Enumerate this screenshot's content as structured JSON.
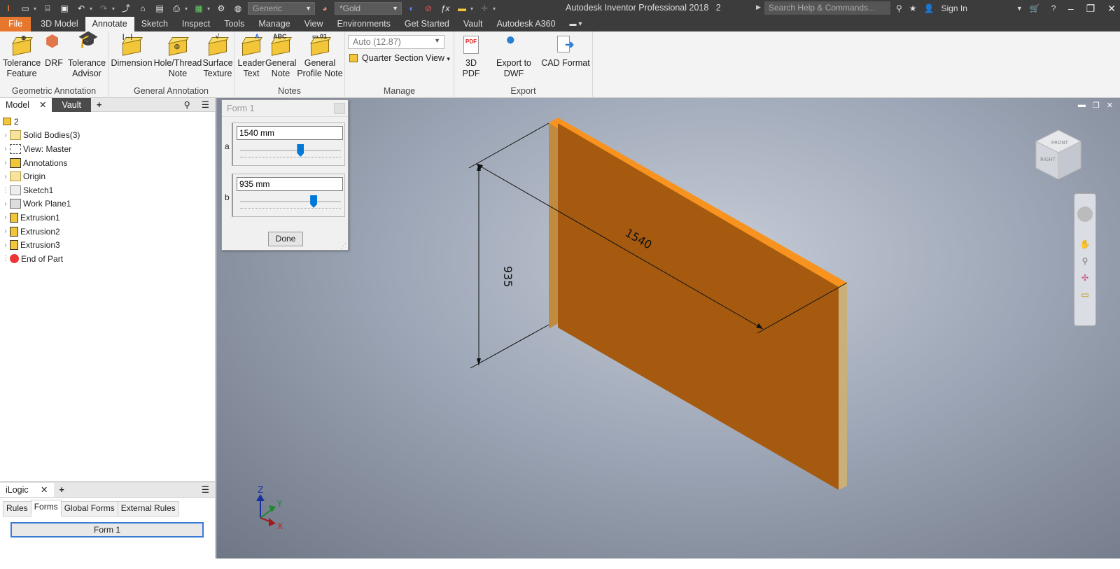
{
  "titlebar": {
    "app_title": "Autodesk Inventor Professional 2018",
    "document": "2",
    "search_placeholder": "Search Help & Commands...",
    "sign_in": "Sign In",
    "material_combo": "Generic",
    "appearance_combo": "*Gold"
  },
  "ribbon_tabs": [
    "File",
    "3D Model",
    "Annotate",
    "Sketch",
    "Inspect",
    "Tools",
    "Manage",
    "View",
    "Environments",
    "Get Started",
    "Vault",
    "Autodesk A360"
  ],
  "active_tab": "Annotate",
  "ribbon": {
    "geometric": {
      "title": "Geometric Annotation",
      "tolerance_feature": [
        "Tolerance",
        "Feature"
      ],
      "drf": "DRF",
      "tolerance_advisor": [
        "Tolerance",
        "Advisor"
      ]
    },
    "general": {
      "title": "General Annotation",
      "dimension": "Dimension",
      "hole_thread": [
        "Hole/Thread",
        "Note"
      ],
      "surface_texture": [
        "Surface",
        "Texture"
      ]
    },
    "notes": {
      "title": "Notes",
      "leader_text": [
        "Leader",
        "Text"
      ],
      "general_note": [
        "General",
        "Note"
      ],
      "general_profile_note": [
        "General",
        "Profile Note"
      ]
    },
    "manage": {
      "title": "Manage",
      "scale_combo": "Auto (12.87)",
      "quarter_section": "Quarter Section View"
    },
    "export": {
      "title": "Export",
      "pdf": "3D PDF",
      "dwf": "Export to DWF",
      "cad": "CAD Format"
    }
  },
  "browser": {
    "tabs": [
      "Model",
      "Vault"
    ],
    "root": "2",
    "items": [
      "Solid Bodies(3)",
      "View: Master",
      "Annotations",
      "Origin",
      "Sketch1",
      "Work Plane1",
      "Extrusion1",
      "Extrusion2",
      "Extrusion3",
      "End of Part"
    ]
  },
  "ilogic": {
    "title": "iLogic",
    "tabs": [
      "Rules",
      "Forms",
      "Global Forms",
      "External Rules"
    ],
    "active_tab": "Forms",
    "form_button": "Form 1"
  },
  "form1": {
    "title": "Form 1",
    "param_a": {
      "label": "a",
      "value": "1540 mm",
      "slider_fraction": 0.6
    },
    "param_b": {
      "label": "b",
      "value": "935 mm",
      "slider_fraction": 0.73
    },
    "done": "Done"
  },
  "viewport": {
    "dim_length": "1540",
    "dim_height": "935",
    "axis_z": "Z",
    "axis_y": "Y",
    "axis_x": "X",
    "viewcube_faces": [
      "FRONT",
      "RIGHT"
    ]
  },
  "colors": {
    "file_tab": "#e8772e",
    "panel_face": "#a55a10",
    "panel_top": "#f7931e",
    "accent_blue": "#0078d7"
  }
}
